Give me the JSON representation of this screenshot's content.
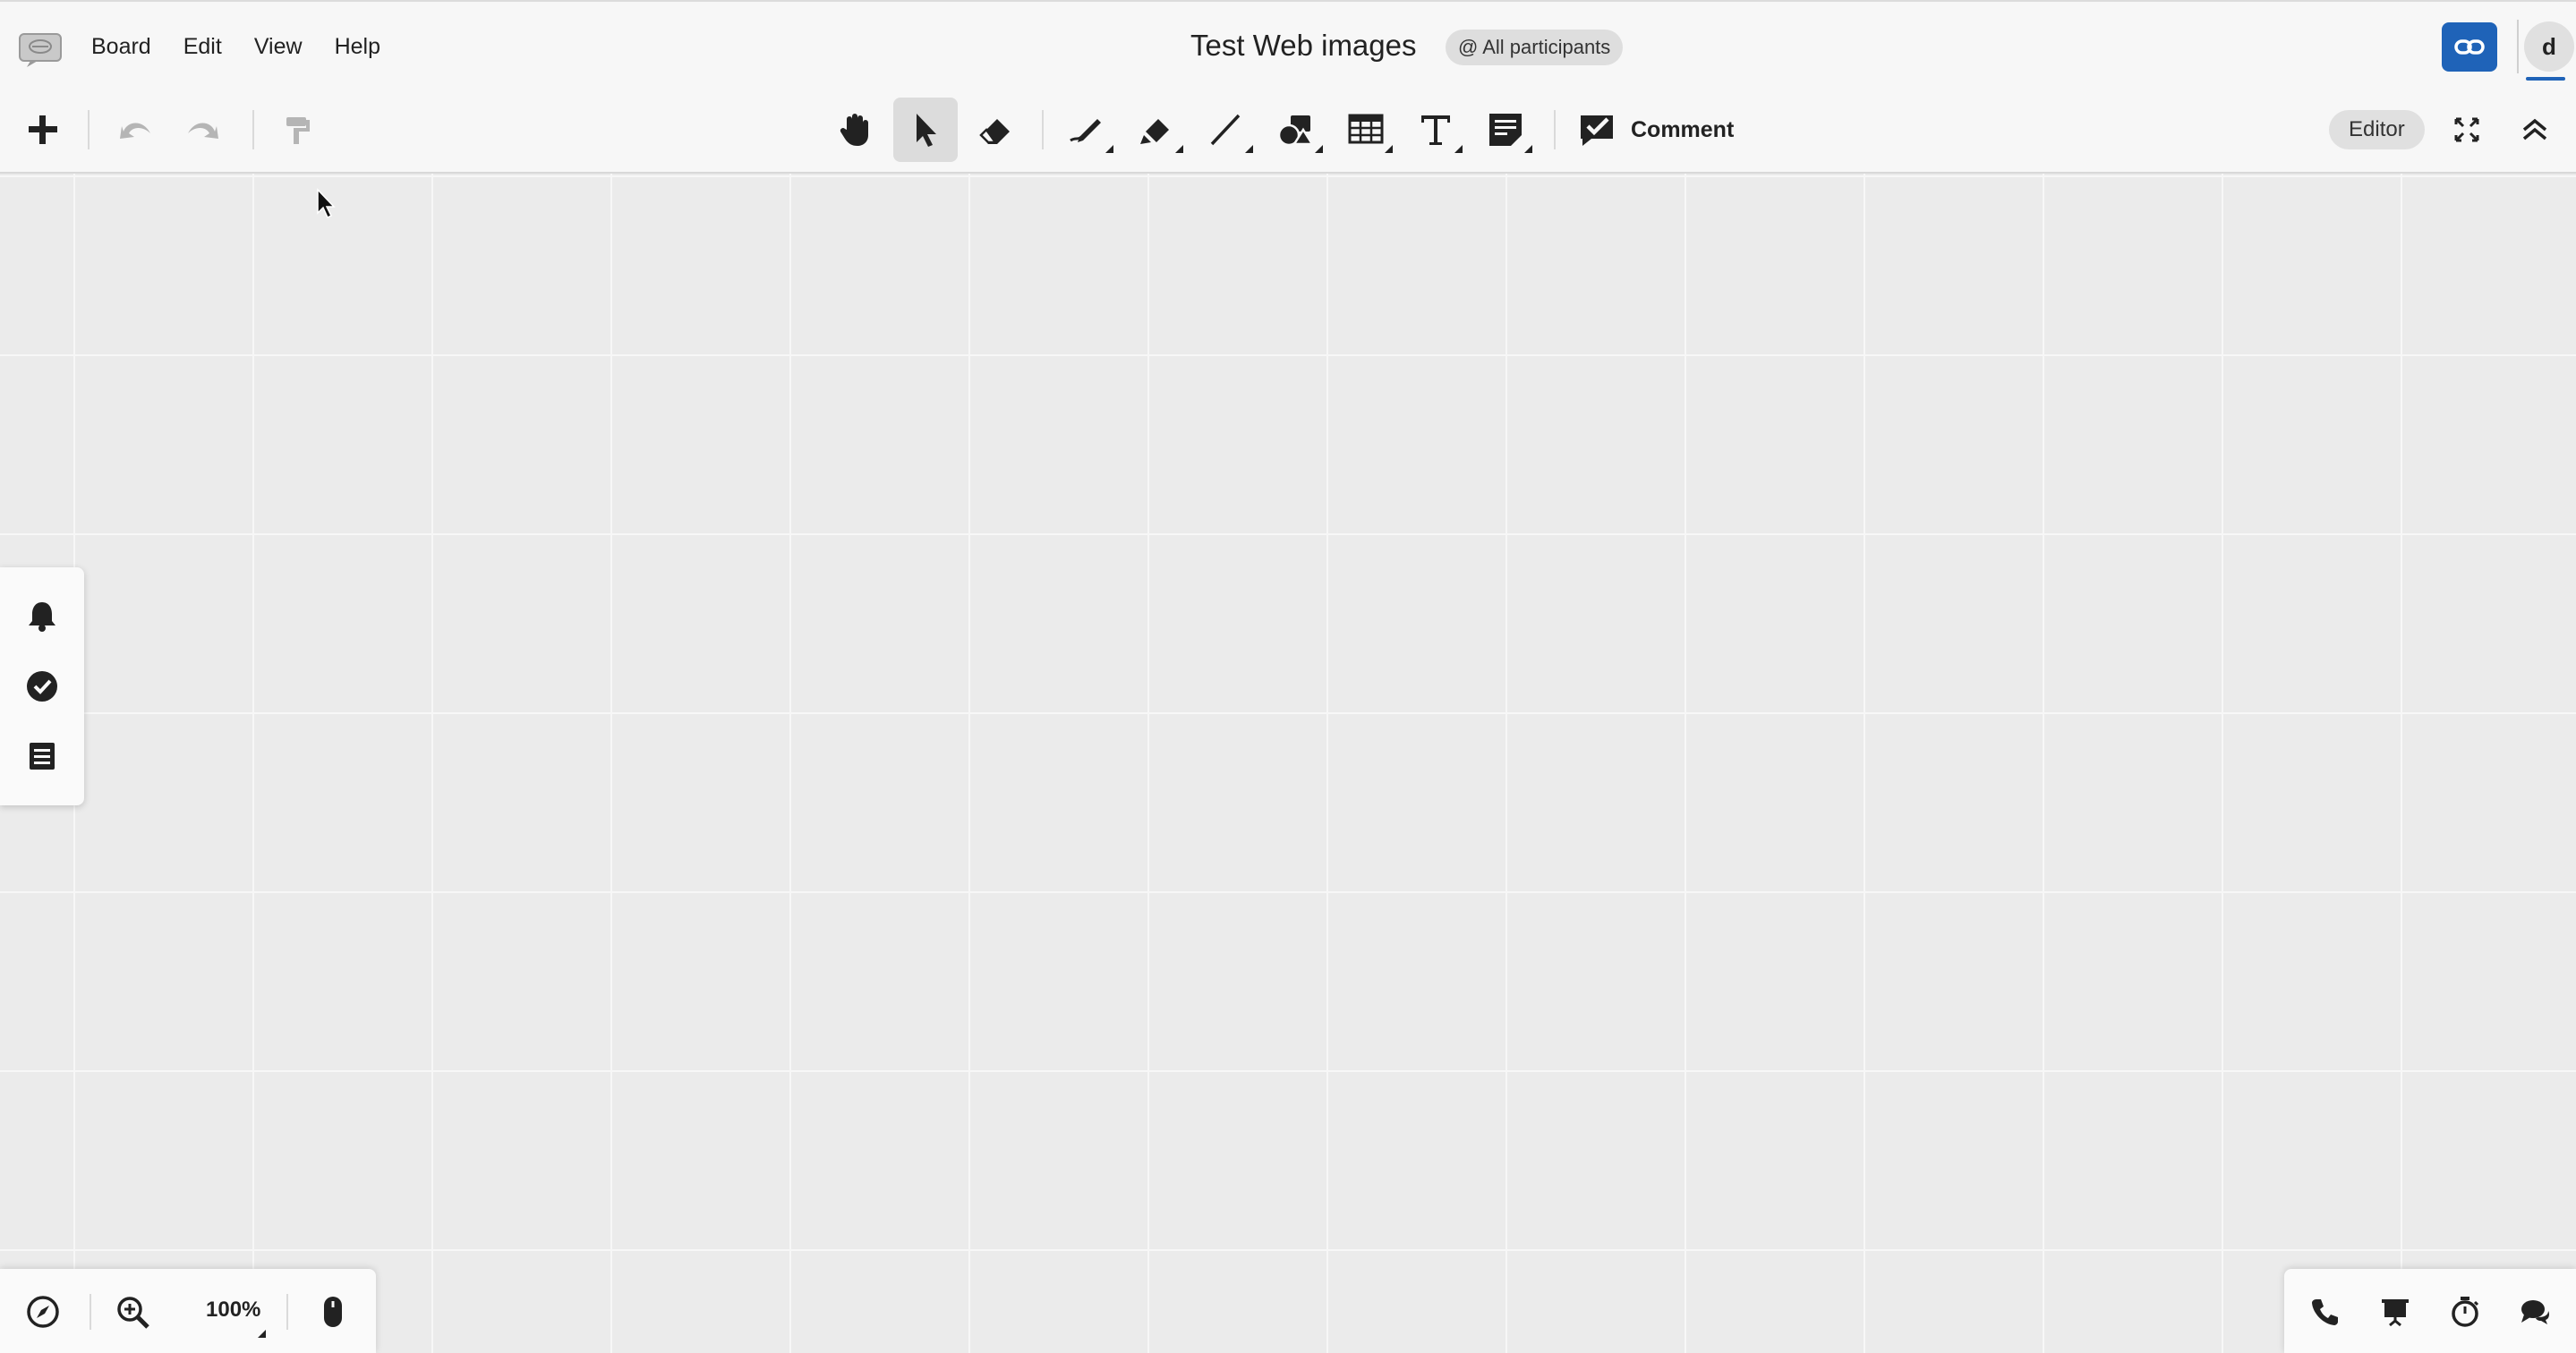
{
  "app": {
    "logo_icon": "whiteboard-chat-icon"
  },
  "menu": {
    "items": [
      "Board",
      "Edit",
      "View",
      "Help"
    ]
  },
  "board": {
    "title": "Test Web images",
    "participants_label": "@ All participants"
  },
  "header": {
    "share_icon": "link-icon",
    "avatar_initial": "d"
  },
  "toolbar": {
    "left_icons": [
      "plus-icon",
      "undo-icon",
      "redo-icon",
      "format-painter-icon"
    ],
    "tools": [
      "hand-icon",
      "pointer-icon",
      "eraser-icon",
      "pen-icon",
      "highlighter-icon",
      "line-icon",
      "shapes-icon",
      "table-icon",
      "text-icon",
      "sticky-note-icon"
    ],
    "active_tool": "pointer-icon",
    "comment_label": "Comment",
    "editor_label": "Editor"
  },
  "left_panel": {
    "icons": [
      "bell-icon",
      "check-circle-icon",
      "list-icon"
    ]
  },
  "bottom_left": {
    "zoom_level": "100%",
    "icons": [
      "compass-icon",
      "zoom-in-icon",
      "mouse-icon"
    ]
  },
  "bottom_right": {
    "icons": [
      "phone-icon",
      "presentation-icon",
      "timer-icon",
      "chat-icon"
    ]
  },
  "colors": {
    "accent": "#1f63b8",
    "canvas": "#ebebeb",
    "grid": "#f7f7f7"
  }
}
